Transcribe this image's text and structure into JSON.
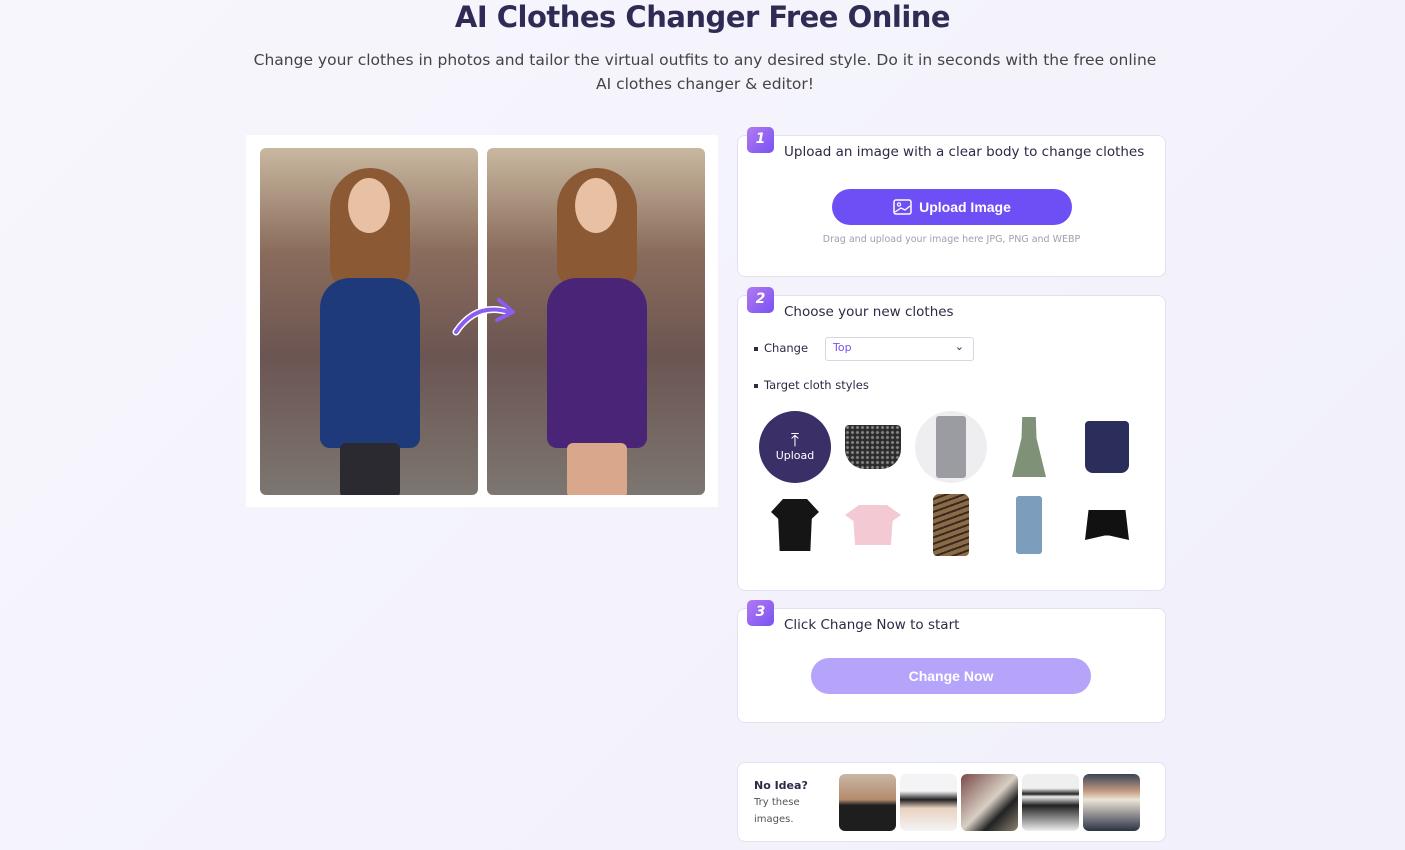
{
  "header": {
    "title": "AI Clothes Changer Free Online",
    "subtitle": "Change your clothes in photos and tailor the virtual outfits to any desired style. Do it in seconds with the free online AI clothes changer & editor!"
  },
  "preview": {
    "before_dress_color": "#1f3a7a",
    "after_dress_color": "#4a2577"
  },
  "step1": {
    "number": "1",
    "title": "Upload an image with a clear body to change clothes",
    "button": "Upload Image",
    "icon": "image-icon",
    "hint": "Drag and upload your image here JPG, PNG and WEBP"
  },
  "step2": {
    "number": "2",
    "title": "Choose your new clothes",
    "change_label": "Change",
    "change_value": "Top",
    "styles_label": "Target cloth styles",
    "upload_label": "Upload",
    "styles": [
      "floral-skirt",
      "grey-jeans",
      "green-floral-dress",
      "navy-camisole",
      "black-tshirt",
      "pink-crop-top",
      "leopard-dress",
      "blue-jeans",
      "black-shorts"
    ]
  },
  "step3": {
    "number": "3",
    "title": "Click Change Now to start",
    "button": "Change Now"
  },
  "ideas": {
    "title": "No Idea?",
    "subtitle": "Try these images."
  },
  "colors": {
    "accent": "#6e4ff6",
    "accent_disabled": "#b6a4fb",
    "dark": "#2e2b55"
  }
}
